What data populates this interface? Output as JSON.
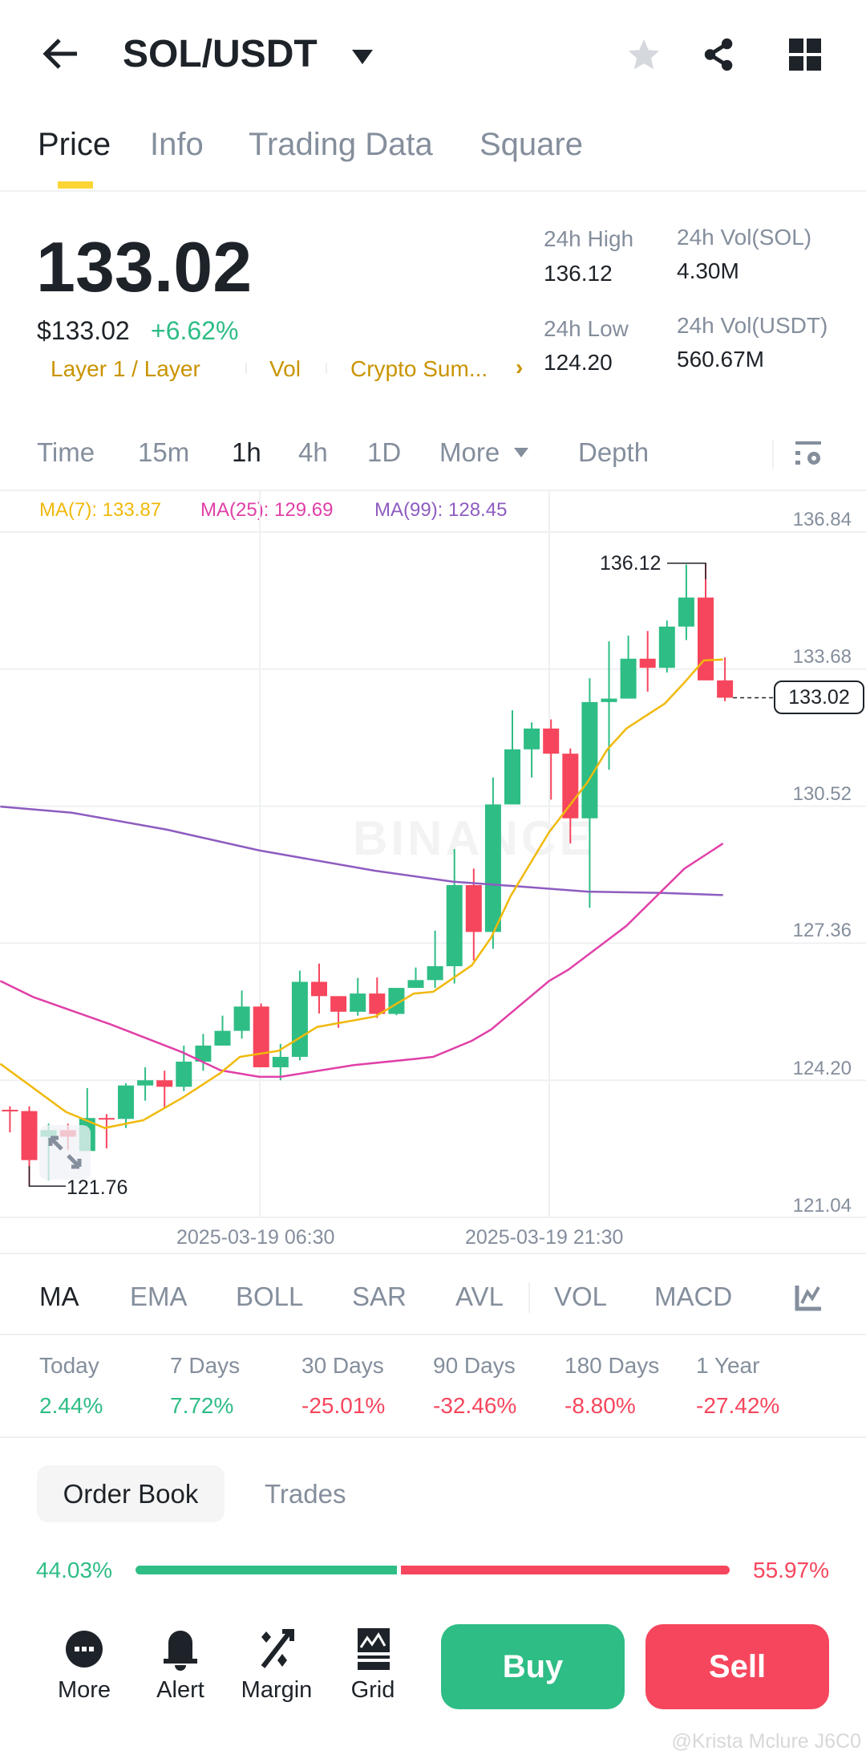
{
  "header": {
    "title": "SOL/USDT",
    "icons": [
      "back-arrow-icon",
      "dropdown-caret-icon",
      "star-icon",
      "share-icon",
      "grid-icon"
    ]
  },
  "tabs": [
    {
      "label": "Price",
      "active": true
    },
    {
      "label": "Info"
    },
    {
      "label": "Trading Data"
    },
    {
      "label": "Square"
    }
  ],
  "ticker": {
    "price": "133.02",
    "usd_price": "$133.02",
    "change": "+6.62%",
    "tags": [
      "Layer 1 / Layer",
      "Vol",
      "Crypto Sum..."
    ],
    "high_label": "24h High",
    "high": "136.12",
    "low_label": "24h Low",
    "low": "124.20",
    "vol_sol_label": "24h Vol(SOL)",
    "vol_sol": "4.30M",
    "vol_usdt_label": "24h Vol(USDT)",
    "vol_usdt": "560.67M"
  },
  "intervals": [
    "Time",
    "15m",
    "1h",
    "4h",
    "1D",
    "More",
    "Depth"
  ],
  "active_interval": "1h",
  "colors": {
    "up": "#2ebd85",
    "down": "#f6465d",
    "ma7": "#f0b90b",
    "ma25": "#e040a8",
    "ma99": "#8e5cc0",
    "accent": "#fcd535"
  },
  "chart_data": {
    "type": "candlestick",
    "legend": {
      "ma7": "MA(7): 133.87",
      "ma25": "MA(25): 129.69",
      "ma99": "MA(99): 128.45"
    },
    "y_ticks": [
      "136.84",
      "133.68",
      "130.52",
      "127.36",
      "124.20",
      "121.04"
    ],
    "ylim": [
      121.04,
      136.84
    ],
    "x_ticks": [
      "2025-03-19 06:30",
      "2025-03-19 21:30"
    ],
    "max_label": "136.12",
    "min_label": "121.76",
    "last_price": "133.02",
    "watermark": "BINANCE",
    "candles": [
      [
        123.52,
        123.6,
        123.0,
        123.5
      ],
      [
        123.49,
        123.6,
        121.76,
        122.36
      ],
      [
        122.9,
        123.2,
        121.9,
        123.05
      ],
      [
        123.05,
        123.2,
        122.6,
        122.9
      ],
      [
        122.57,
        124.02,
        122.57,
        123.33
      ],
      [
        123.33,
        123.42,
        122.63,
        123.3
      ],
      [
        123.31,
        124.13,
        123.1,
        124.08
      ],
      [
        124.08,
        124.5,
        123.73,
        124.2
      ],
      [
        124.2,
        124.42,
        123.55,
        124.05
      ],
      [
        124.05,
        125.0,
        123.95,
        124.63
      ],
      [
        124.63,
        125.27,
        124.42,
        125.0
      ],
      [
        125.0,
        125.69,
        125.0,
        125.34
      ],
      [
        125.34,
        126.27,
        125.16,
        125.9
      ],
      [
        125.9,
        125.97,
        124.5,
        124.5
      ],
      [
        124.5,
        125.04,
        124.2,
        124.74
      ],
      [
        124.74,
        126.73,
        124.66,
        126.47
      ],
      [
        126.47,
        126.89,
        125.74,
        126.14
      ],
      [
        126.14,
        126.14,
        125.41,
        125.78
      ],
      [
        125.78,
        126.56,
        125.69,
        126.2
      ],
      [
        126.2,
        126.57,
        125.64,
        125.73
      ],
      [
        125.73,
        126.33,
        125.7,
        126.33
      ],
      [
        126.33,
        126.8,
        126.33,
        126.51
      ],
      [
        126.51,
        127.65,
        126.33,
        126.83
      ],
      [
        126.83,
        129.53,
        126.43,
        128.7
      ],
      [
        128.7,
        129.08,
        126.96,
        127.62
      ],
      [
        127.62,
        131.18,
        127.23,
        130.56
      ],
      [
        130.56,
        132.73,
        130.56,
        131.83
      ],
      [
        131.83,
        132.45,
        131.18,
        132.31
      ],
      [
        132.31,
        132.52,
        130.67,
        131.73
      ],
      [
        131.73,
        131.85,
        129.66,
        130.24
      ],
      [
        130.24,
        133.47,
        128.18,
        132.92
      ],
      [
        132.92,
        134.32,
        131.36,
        133.0
      ],
      [
        133.0,
        134.45,
        133.0,
        133.92
      ],
      [
        133.92,
        134.56,
        133.16,
        133.71
      ],
      [
        133.71,
        134.8,
        133.6,
        134.66
      ],
      [
        134.66,
        136.09,
        134.35,
        135.33
      ],
      [
        135.33,
        136.12,
        133.42,
        133.42
      ],
      [
        133.42,
        133.95,
        132.94,
        133.02
      ]
    ],
    "ma7": [
      [
        -0.5,
        124.58
      ],
      [
        2.9,
        123.47
      ],
      [
        4.9,
        123.1
      ],
      [
        6.9,
        123.28
      ],
      [
        8.9,
        123.79
      ],
      [
        10.9,
        124.37
      ],
      [
        11.9,
        124.74
      ],
      [
        13.9,
        124.88
      ],
      [
        15.9,
        125.43
      ],
      [
        18.9,
        125.67
      ],
      [
        20.9,
        126.2
      ],
      [
        21.9,
        126.24
      ],
      [
        23.9,
        126.85
      ],
      [
        24.9,
        127.49
      ],
      [
        25.9,
        128.44
      ],
      [
        27.9,
        129.92
      ],
      [
        29.9,
        131.08
      ],
      [
        30.9,
        131.82
      ],
      [
        31.9,
        132.31
      ],
      [
        33.9,
        132.89
      ],
      [
        34.9,
        133.37
      ],
      [
        35.9,
        133.88
      ],
      [
        36.9,
        133.9
      ]
    ],
    "ma25": [
      [
        -0.5,
        126.49
      ],
      [
        1.2,
        126.12
      ],
      [
        5.2,
        125.49
      ],
      [
        8.9,
        124.85
      ],
      [
        10.9,
        124.43
      ],
      [
        12.9,
        124.28
      ],
      [
        14,
        124.28
      ],
      [
        17.8,
        124.55
      ],
      [
        20.9,
        124.69
      ],
      [
        21.9,
        124.74
      ],
      [
        23.9,
        125.11
      ],
      [
        24.9,
        125.37
      ],
      [
        27.9,
        126.49
      ],
      [
        28.9,
        126.75
      ],
      [
        31.9,
        127.76
      ],
      [
        34.9,
        129.08
      ],
      [
        36.9,
        129.66
      ]
    ],
    "ma99": [
      [
        -0.5,
        130.51
      ],
      [
        3.2,
        130.37
      ],
      [
        8.1,
        129.98
      ],
      [
        12.9,
        129.5
      ],
      [
        18.9,
        129.03
      ],
      [
        22.9,
        128.78
      ],
      [
        26,
        128.68
      ],
      [
        29.9,
        128.55
      ],
      [
        33.8,
        128.52
      ],
      [
        36.9,
        128.47
      ]
    ]
  },
  "indicators": [
    "MA",
    "EMA",
    "BOLL",
    "SAR",
    "AVL",
    "VOL",
    "MACD"
  ],
  "performance": [
    {
      "label": "Today",
      "value": "2.44%"
    },
    {
      "label": "7 Days",
      "value": "7.72%"
    },
    {
      "label": "30 Days",
      "value": "-25.01%"
    },
    {
      "label": "90 Days",
      "value": "-32.46%"
    },
    {
      "label": "180 Days",
      "value": "-8.80%"
    },
    {
      "label": "1 Year",
      "value": "-27.42%"
    }
  ],
  "orderbook": {
    "tabs": [
      "Order Book",
      "Trades"
    ],
    "bid_pct": "44.03%",
    "ask_pct": "55.97%",
    "bid_ratio": 44.03
  },
  "bottom": {
    "more": "More",
    "alert": "Alert",
    "margin": "Margin",
    "grid": "Grid",
    "buy": "Buy",
    "sell": "Sell"
  },
  "watermark": "@Krista Mclure J6C0"
}
